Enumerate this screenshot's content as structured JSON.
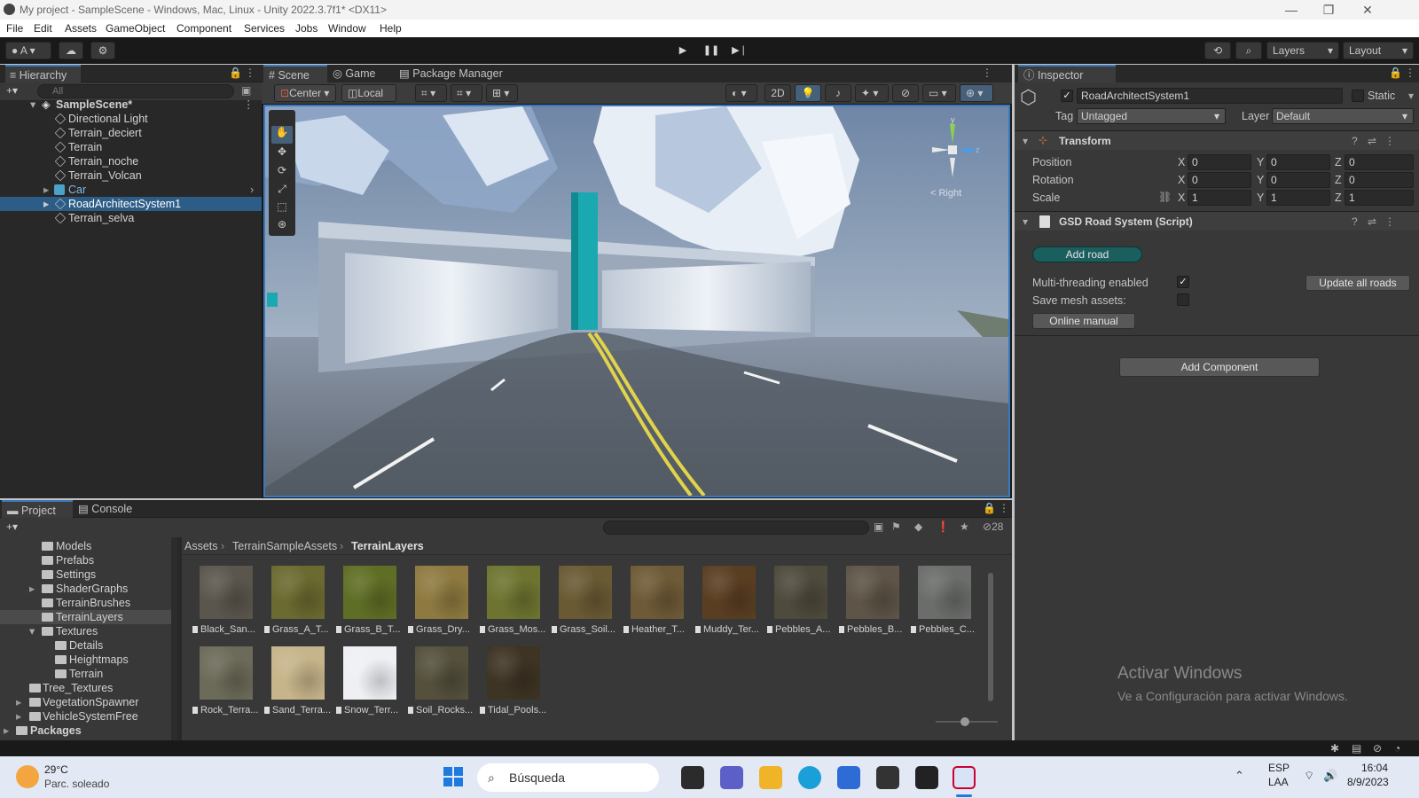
{
  "titlebar": {
    "title": "My project - SampleScene - Windows, Mac, Linux - Unity 2022.3.7f1* <DX11>"
  },
  "menu": [
    "File",
    "Edit",
    "Assets",
    "GameObject",
    "Component",
    "Services",
    "Jobs",
    "Window",
    "Help"
  ],
  "toolbar": {
    "account": "A",
    "layers": "Layers",
    "layout": "Layout"
  },
  "hierarchy": {
    "tab": "Hierarchy",
    "search_placeholder": "All",
    "scene": "SampleScene*",
    "items": [
      "Directional Light",
      "Terrain_deciert",
      "Terrain",
      "Terrain_noche",
      "Terrain_Volcan",
      "Car",
      "RoadArchitectSystem1",
      "Terrain_selva"
    ]
  },
  "scene_view": {
    "tabs": [
      "Scene",
      "Game",
      "Package Manager"
    ],
    "pivot": "Center",
    "space": "Local",
    "mode_2d": "2D",
    "gizmo_label": "Right"
  },
  "inspector": {
    "tab": "Inspector",
    "object_name": "RoadArchitectSystem1",
    "static_label": "Static",
    "tag_label": "Tag",
    "tag_value": "Untagged",
    "layer_label": "Layer",
    "layer_value": "Default",
    "transform": {
      "title": "Transform",
      "position_label": "Position",
      "rotation_label": "Rotation",
      "scale_label": "Scale",
      "axis_x": "X",
      "axis_y": "Y",
      "axis_z": "Z",
      "position": [
        "0",
        "0",
        "0"
      ],
      "rotation": [
        "0",
        "0",
        "0"
      ],
      "scale": [
        "1",
        "1",
        "1"
      ]
    },
    "script": {
      "title": "GSD Road System (Script)",
      "add_road": "Add road",
      "multithreading_label": "Multi-threading enabled",
      "multithreading_checked": "✓",
      "update_all": "Update all roads",
      "save_mesh_label": "Save mesh assets:",
      "online_manual": "Online manual"
    },
    "add_component": "Add Component"
  },
  "project": {
    "tabs": [
      "Project",
      "Console"
    ],
    "hidden_count": "28",
    "tree": [
      "Models",
      "Prefabs",
      "Settings",
      "ShaderGraphs",
      "TerrainBrushes",
      "TerrainLayers",
      "Textures",
      "Details",
      "Heightmaps",
      "Terrain",
      "Tree_Textures",
      "VegetationSpawner",
      "VehicleSystemFree",
      "Packages"
    ],
    "breadcrumb": [
      "Assets",
      "TerrainSampleAssets",
      "TerrainLayers"
    ],
    "assets": [
      {
        "name": "Black_San...",
        "color": "#5b564d"
      },
      {
        "name": "Grass_A_T...",
        "color": "#6b6a30"
      },
      {
        "name": "Grass_B_T...",
        "color": "#5f6e25"
      },
      {
        "name": "Grass_Dry...",
        "color": "#8e7a40"
      },
      {
        "name": "Grass_Mos...",
        "color": "#6e7430"
      },
      {
        "name": "Grass_Soil...",
        "color": "#6a5a34"
      },
      {
        "name": "Heather_T...",
        "color": "#6e5a36"
      },
      {
        "name": "Muddy_Ter...",
        "color": "#5a3e22"
      },
      {
        "name": "Pebbles_A...",
        "color": "#4e4a3c"
      },
      {
        "name": "Pebbles_B...",
        "color": "#5e5447"
      },
      {
        "name": "Pebbles_C...",
        "color": "#6a6d6a"
      },
      {
        "name": "Rock_Terra...",
        "color": "#6c6a58"
      },
      {
        "name": "Sand_Terra...",
        "color": "#c6b48a"
      },
      {
        "name": "Snow_Terr...",
        "color": "#eef0f4"
      },
      {
        "name": "Soil_Rocks...",
        "color": "#54503c"
      },
      {
        "name": "Tidal_Pools...",
        "color": "#3e3424"
      }
    ]
  },
  "watermark": {
    "title": "Activar Windows",
    "subtitle": "Ve a Configuración para activar Windows."
  },
  "taskbar": {
    "temp": "29°C",
    "weather": "Parc. soleado",
    "search": "Búsqueda",
    "lang1": "ESP",
    "lang2": "LAA",
    "time": "16:04",
    "date": "8/9/2023"
  },
  "colors": {
    "selection": "#2c5d87",
    "accent": "#3a79bb",
    "add_road": "#1b5e5e"
  }
}
